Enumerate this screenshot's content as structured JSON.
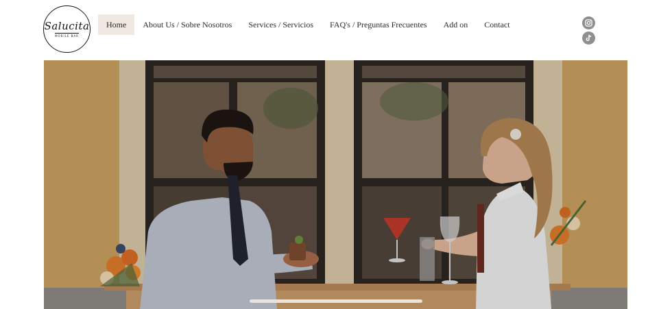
{
  "brand": {
    "logo_script": "Salucita",
    "logo_subtext": "MOBILE BAR"
  },
  "nav": {
    "items": [
      {
        "label": "Home",
        "active": true
      },
      {
        "label": "About Us / Sobre Nosotros",
        "active": false
      },
      {
        "label": "Services / Servicios",
        "active": false
      },
      {
        "label": "FAQ's / Preguntas Frecuentes",
        "active": false
      },
      {
        "label": "Add on",
        "active": false
      },
      {
        "label": "Contact",
        "active": false
      }
    ]
  },
  "social": {
    "icons": [
      "instagram-icon",
      "tiktok-icon"
    ],
    "icon_color": "#8f8f8f"
  },
  "hero": {
    "description_icon": "photo",
    "palette": {
      "wall": "#c59a57",
      "window_frame": "#2b2520",
      "shirt": "#bcc3cf",
      "dress": "#eeeeee",
      "cocktail": "#c0392b",
      "flowers": "#e07b2a"
    }
  },
  "colors": {
    "nav_active_bg": "#efe9e1",
    "text": "#2a2a2a"
  }
}
